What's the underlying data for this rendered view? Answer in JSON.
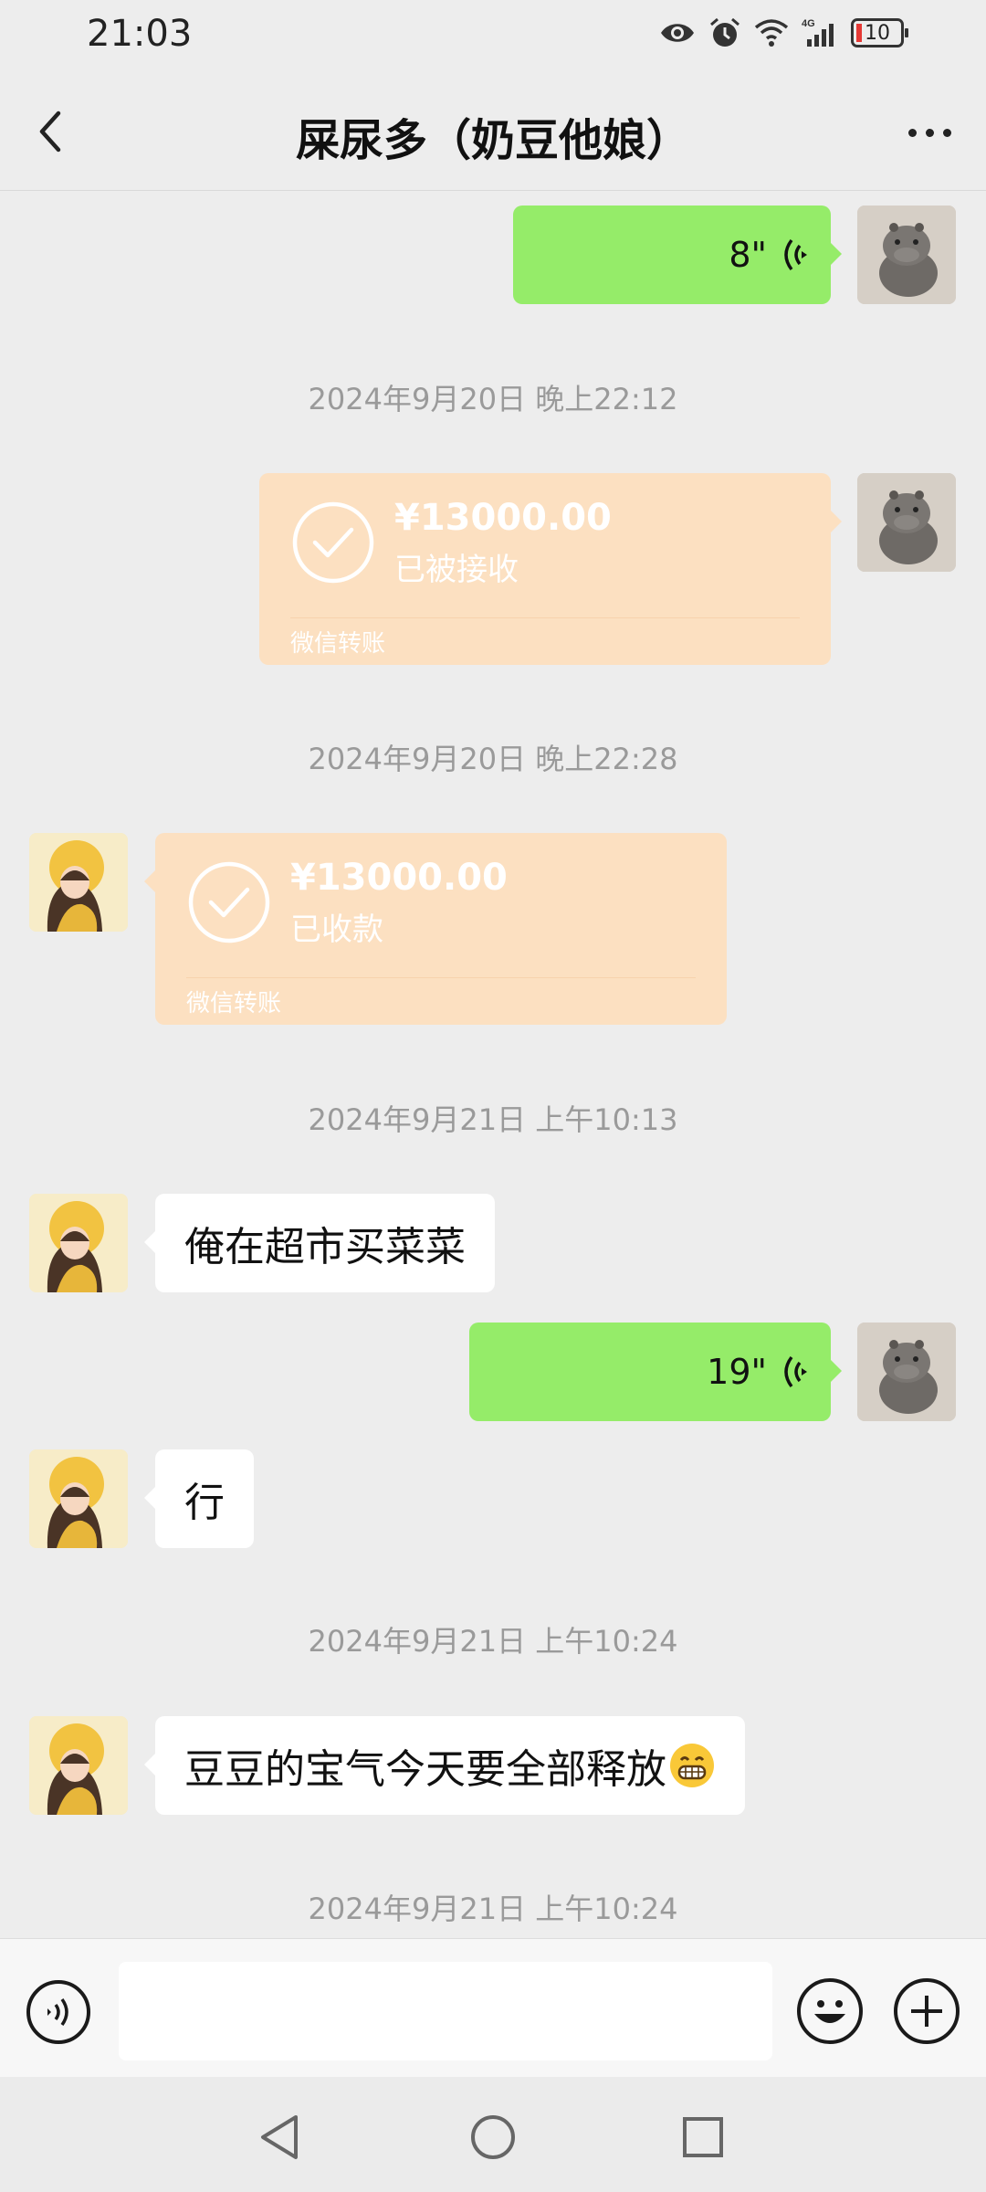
{
  "status_bar": {
    "time": "21:03",
    "network": "4G",
    "battery": "10"
  },
  "header": {
    "title": "屎尿多（奶豆他娘）"
  },
  "messages": [
    {
      "type": "voice",
      "from": "me",
      "duration": "8\""
    },
    {
      "type": "timestamp",
      "text": "2024年9月20日 晚上22:12"
    },
    {
      "type": "transfer",
      "from": "me",
      "amount": "¥13000.00",
      "status": "已被接收",
      "label": "微信转账"
    },
    {
      "type": "timestamp",
      "text": "2024年9月20日 晚上22:28"
    },
    {
      "type": "transfer",
      "from": "peer",
      "amount": "¥13000.00",
      "status": "已收款",
      "label": "微信转账"
    },
    {
      "type": "timestamp",
      "text": "2024年9月21日 上午10:13"
    },
    {
      "type": "text",
      "from": "peer",
      "text": "俺在超市买菜菜"
    },
    {
      "type": "voice",
      "from": "me",
      "duration": "19\""
    },
    {
      "type": "text",
      "from": "peer",
      "text": "行"
    },
    {
      "type": "timestamp",
      "text": "2024年9月21日 上午10:24"
    },
    {
      "type": "text",
      "from": "peer",
      "text": "豆豆的宝气今天要全部释放",
      "emoji": "grinning-face-emoji"
    },
    {
      "type": "timestamp",
      "text": "2024年9月21日 上午10:24"
    }
  ],
  "input_bar": {
    "placeholder": "",
    "icons": [
      "voice-mode-icon",
      "emoji-icon",
      "plus-icon"
    ]
  },
  "system_nav": {
    "icons": [
      "back-triangle-icon",
      "home-circle-icon",
      "recents-square-icon"
    ]
  },
  "colors": {
    "background": "#ededed",
    "my_bubble": "#95ec69",
    "peer_bubble": "#ffffff",
    "transfer_card": "#fce0c1",
    "timestamp": "#9a9a9a"
  }
}
